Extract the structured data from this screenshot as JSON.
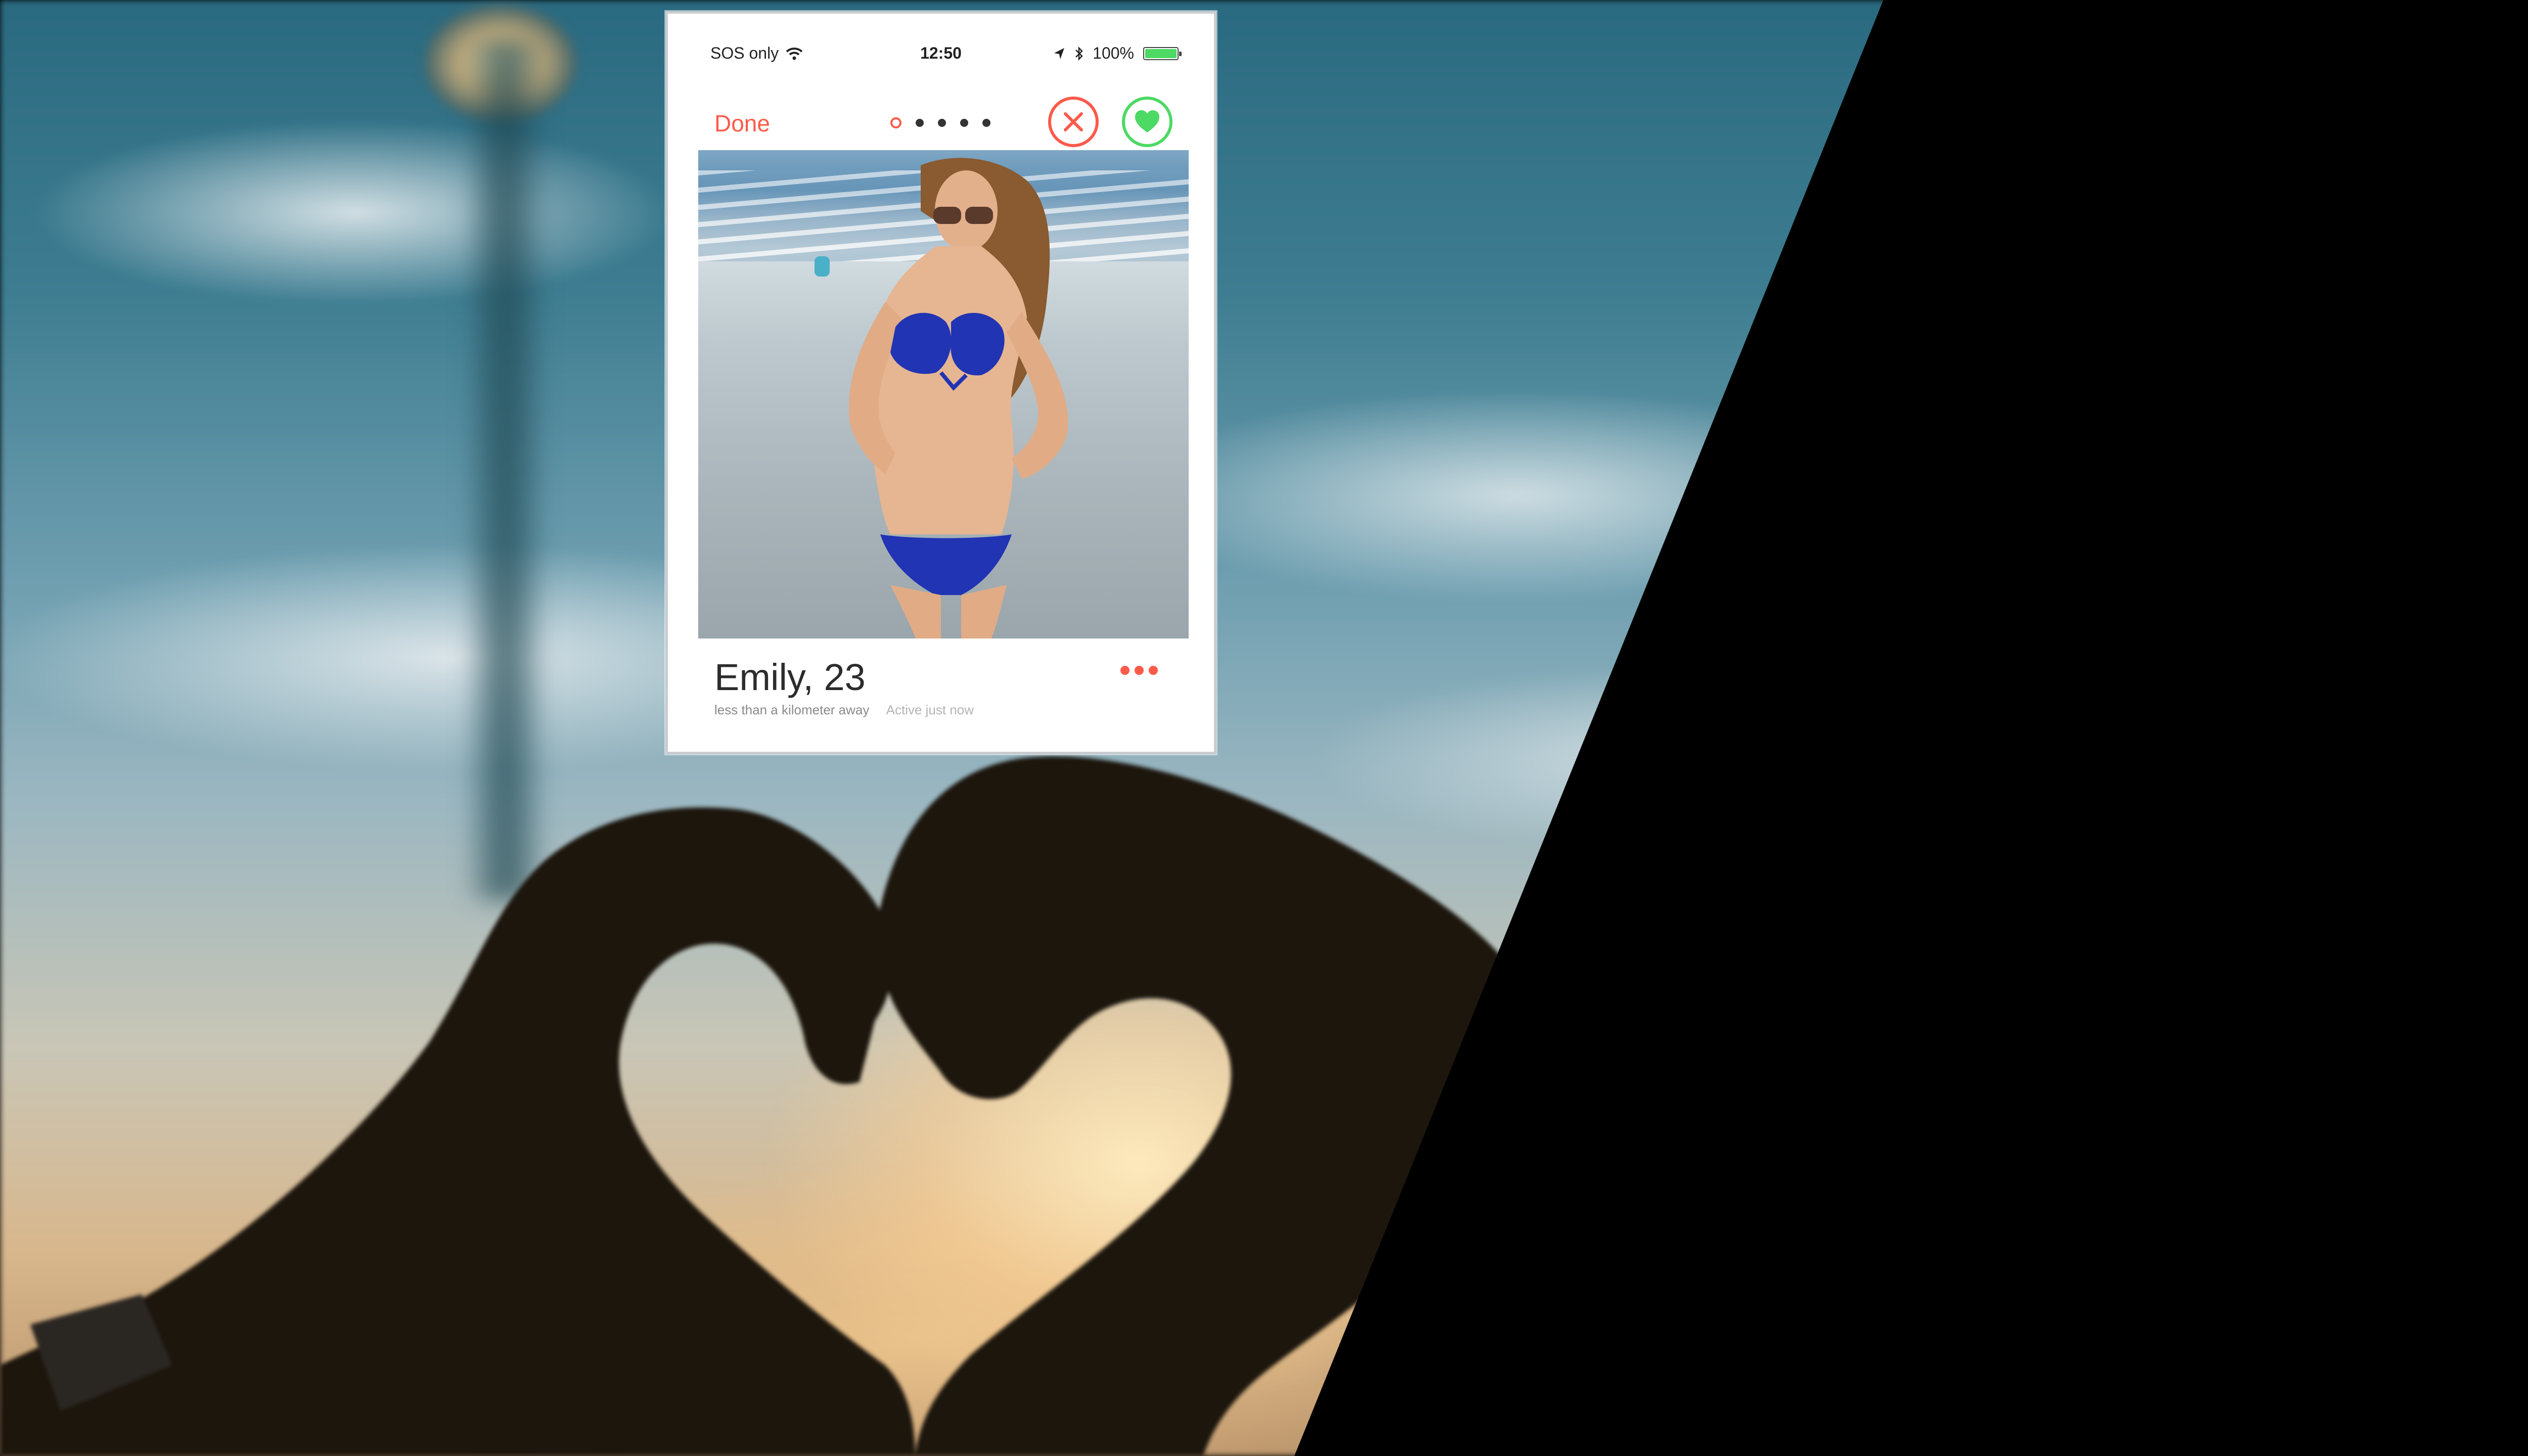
{
  "colors": {
    "accent": "#fd5a4a",
    "like": "#4cd964",
    "battery": "#4cd964"
  },
  "status_bar": {
    "carrier": "SOS only",
    "wifi_icon": "wifi-icon",
    "time": "12:50",
    "location_icon": "location-arrow-icon",
    "bluetooth_icon": "bluetooth-icon",
    "battery_percent": "100%",
    "battery_level": 1.0
  },
  "nav": {
    "done_label": "Done",
    "photo_count": 5,
    "active_photo_index": 0,
    "nope_icon": "close-icon",
    "like_icon": "heart-icon"
  },
  "profile": {
    "name_age": "Emily, 23",
    "distance": "less than a kilometer away",
    "activity": "Active just now",
    "more_icon": "more-dots-icon"
  }
}
